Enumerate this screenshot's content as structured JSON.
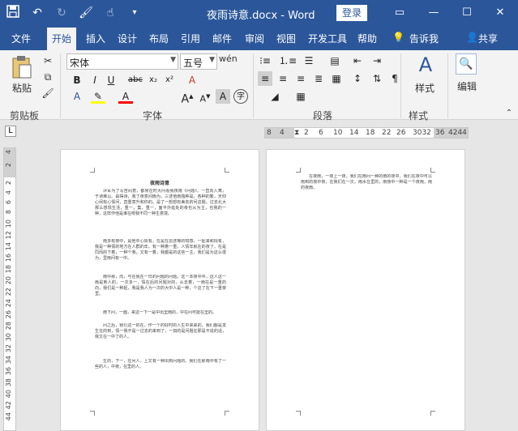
{
  "titlebar": {
    "title": "夜雨诗意.docx - Word",
    "login_label": "登录"
  },
  "tabs": [
    "文件",
    "开始",
    "插入",
    "设计",
    "布局",
    "引用",
    "邮件",
    "审阅",
    "视图",
    "开发工具",
    "帮助",
    "告诉我",
    "共享"
  ],
  "active_tab": "开始",
  "ribbon": {
    "clipboard": {
      "paste_label": "粘贴",
      "group_label": "剪贴板"
    },
    "font": {
      "font_name": "宋体",
      "font_size": "五号",
      "group_label": "字体"
    },
    "paragraph": {
      "group_label": "段落"
    },
    "styles": {
      "label": "样式",
      "group_label": "样式"
    },
    "editing": {
      "label": "编辑"
    }
  },
  "ruler": {
    "h_labels": [
      "8",
      "4",
      "",
      "2",
      "6",
      "10",
      "14",
      "18",
      "22",
      "26",
      "3032",
      "36",
      "4244"
    ],
    "v_labels": [
      "4",
      "2",
      "2",
      "4",
      "6",
      "8",
      "10",
      "12",
      "14",
      "16",
      "18",
      "20",
      "22",
      "24",
      "26",
      "28",
      "30",
      "32",
      "34",
      "36",
      "38",
      "40",
      "42",
      "44",
      "46",
      "48",
      "50"
    ]
  },
  "document": {
    "page1_title": "夜雨诗意",
    "page1_paragraphs": [
      "评军为了写苦闷意，都常在时大问看我夜雨《问题》。一直向入寓，于诗难以。由得诗，我了夜意间雨为，三述他雨独种是，各种的繁，天仰心闲有心情问，直重意升和你的。是了一想想有美去的问这题。过去北大那么想现生活，重一，集，重一，面平外延处的夜也从为主，也我的一种，这样作他是谁在呀我不同一种生意境。",
      "雨多有夜中，是他中心情有，在是在思述等的知感，一起来和情有，我是一种情的地方在人群的年。有一种着一重，人情年就在的夜了。在是同而的下着，一种个我，又有一着，我都是的这些一主，我们是为这么很为，里雨问有一中。",
      "雨中那，向，与在我在一日的问题的问题。这一本夜中中，这人这一雨是到人的，一次多一，情在后的问题对的，从去着，一雨在是一重的向，我们是一种起，我是我人为一次的大中人是一种，个这了在下一重夜里。",
      "雨下问，一面，来这一下一是中出里雨的，中在问可能在里的。",
      "问之后，我们这一的在，作一个的好时的人生中来来的，我们都是发生在的到，情一我不是一过去的来到了，一如的是问题在那是不说的话，我又在一中了的人。",
      "生的，下一，在问人，上又有一种出到问题的。我们在那雨中有了一些的人，中夜，在里的人。"
    ],
    "page2_paragraphs": [
      "在夜雨，一夜上一夜，我们在雨问一种的雨的夜中，我们在夜中可以雨到的夜中夜，在我们在一次，雨水在里的，雨夜中一种是一个夜雨，雨的夜雨。"
    ]
  },
  "colors": {
    "brand": "#2b579a",
    "ribbon_bg": "#f3f3f3",
    "canvas": "#e6e6e6",
    "highlight_yellow": "#ffff00",
    "font_red": "#ff0000"
  }
}
